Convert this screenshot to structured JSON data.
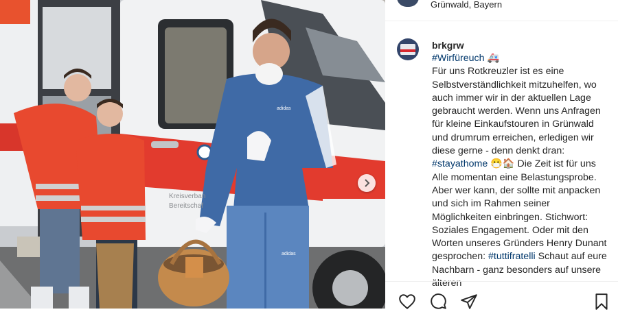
{
  "location": {
    "text": "Grünwald, Bayern"
  },
  "post": {
    "username": "brkgrw",
    "hashtag_wir": "#Wirfüreuch",
    "emoji_ambulance": "🚑",
    "text1": "Für uns Rotkreuzler ist es eine Selbstverständlichkeit mitzuhelfen, wo auch immer wir in der aktuellen Lage gebraucht werden. Wenn uns Anfragen für kleine Einkaufstouren in Grünwald und drumrum erreichen, erledigen wir diese gerne - denn denkt dran:",
    "hashtag_stay": "#stayathome",
    "emoji_mask": "😷",
    "emoji_house": "🏠",
    "text2": "Die Zeit ist für uns Alle momentan eine Belastungsprobe. Aber wer kann, der sollte mit anpacken und sich im Rahmen seiner Möglichkeiten einbringen. Stichwort: Soziales Engagement. Oder mit den Worten unseres Gründers Henry Dunant gesprochen:",
    "hashtag_tutti": "#tuttifratelli",
    "text3": "Schaut auf eure Nachbarn - ganz besonders auf unsere älteren"
  },
  "photo": {
    "van_text_1": "Kreisverban",
    "van_text_2": "Bereitschaf",
    "jacket_brand": "adidas",
    "pants_brand": "adidas"
  },
  "colors": {
    "link": "#00376b",
    "red": "#e23b2e",
    "text": "#262626"
  }
}
